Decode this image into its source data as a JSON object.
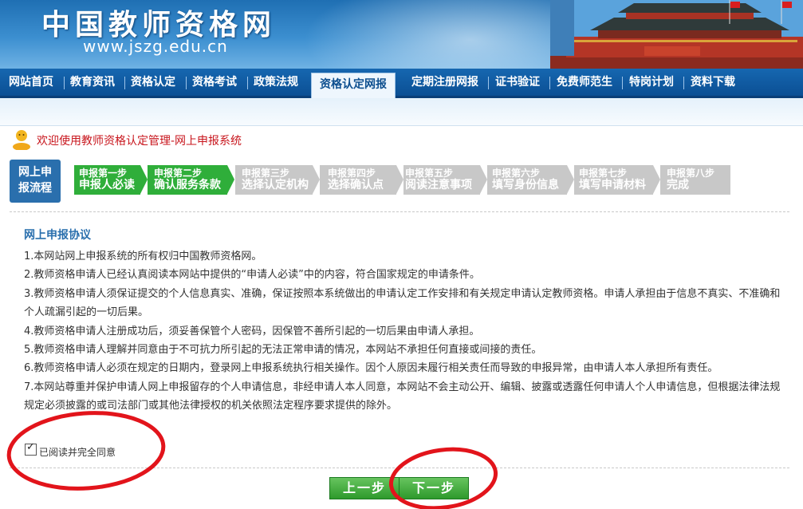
{
  "header": {
    "site_title": "中国教师资格网",
    "site_url": "www.jszg.edu.cn"
  },
  "nav": {
    "items": [
      {
        "label": "网站首页",
        "active": false
      },
      {
        "label": "教育资讯",
        "active": false
      },
      {
        "label": "资格认定",
        "active": false
      },
      {
        "label": "资格考试",
        "active": false
      },
      {
        "label": "政策法规",
        "active": false
      },
      {
        "label": "资格认定网报",
        "active": true
      },
      {
        "label": "定期注册网报",
        "active": false
      },
      {
        "label": "证书验证",
        "active": false
      },
      {
        "label": "免费师范生",
        "active": false
      },
      {
        "label": "特岗计划",
        "active": false
      },
      {
        "label": "资料下载",
        "active": false
      }
    ]
  },
  "welcome": {
    "text": "欢迎使用教师资格认定管理-网上申报系统"
  },
  "flow": {
    "label_line1": "网上申",
    "label_line2": "报流程",
    "steps": [
      {
        "line1": "申报第一步",
        "line2": "申报人必读",
        "done": true
      },
      {
        "line1": "申报第二步",
        "line2": "确认服务条款",
        "done": true
      },
      {
        "line1": "申报第三步",
        "line2": "选择认定机构",
        "done": false
      },
      {
        "line1": "申报第四步",
        "line2": "选择确认点",
        "done": false
      },
      {
        "line1": "申报第五步",
        "line2": "阅读注意事项",
        "done": false
      },
      {
        "line1": "申报第六步",
        "line2": "填写身份信息",
        "done": false
      },
      {
        "line1": "申报第七步",
        "line2": "填写申请材料",
        "done": false
      },
      {
        "line1": "申报第八步",
        "line2": "完成",
        "done": false
      }
    ]
  },
  "protocol": {
    "title": "网上申报协议",
    "clauses": [
      "1.本网站网上申报系统的所有权归中国教师资格网。",
      "2.教师资格申请人已经认真阅读本网站中提供的“申请人必读”中的内容，符合国家规定的申请条件。",
      "3.教师资格申请人须保证提交的个人信息真实、准确，保证按照本系统做出的申请认定工作安排和有关规定申请认定教师资格。申请人承担由于信息不真实、不准确和个人疏漏引起的一切后果。",
      "4.教师资格申请人注册成功后，须妥善保管个人密码，因保管不善所引起的一切后果由申请人承担。",
      "5.教师资格申请人理解并同意由于不可抗力所引起的无法正常申请的情况，本网站不承担任何直接或间接的责任。",
      "6.教师资格申请人必须在规定的日期内，登录网上申报系统执行相关操作。因个人原因未履行相关责任而导致的申报异常，由申请人本人承担所有责任。",
      "7.本网站尊重并保护申请人网上申报留存的个人申请信息，非经申请人本人同意，本网站不会主动公开、编辑、披露或透露任何申请人个人申请信息，但根据法律法规规定必须披露的或司法部门或其他法律授权的机关依照法定程序要求提供的除外。"
    ]
  },
  "agree": {
    "label": "已阅读并完全同意",
    "checked": true
  },
  "buttons": {
    "prev": "上一步",
    "next": "下一步"
  },
  "colors": {
    "nav_bg": "#0b4f94",
    "step_done": "#2fae3a",
    "step_todo": "#c8c8c8",
    "welcome_text": "#c8161d",
    "annotation": "#e2141b"
  }
}
